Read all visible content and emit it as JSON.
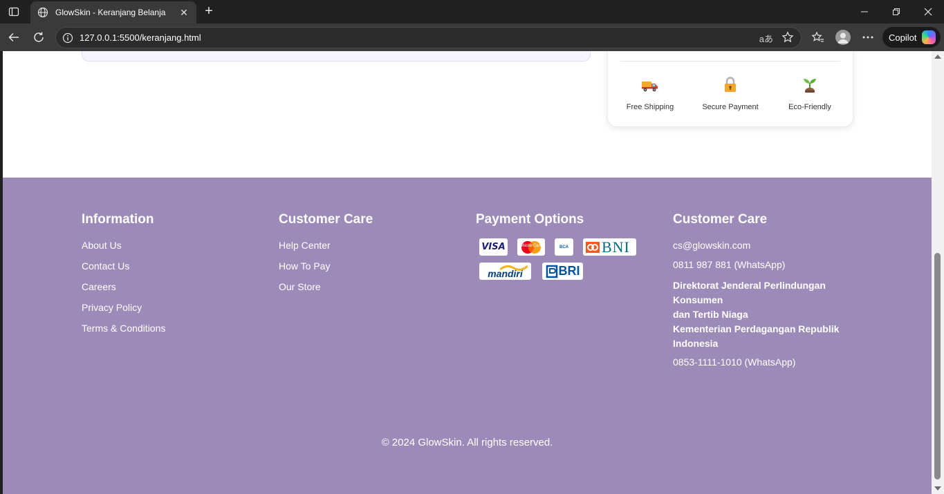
{
  "browser": {
    "tab_title": "GlowSkin - Keranjang Belanja",
    "url": "127.0.0.1:5500/keranjang.html",
    "read_aloud_label": "aあ",
    "copilot_label": "Copilot",
    "new_tab_label": "+",
    "tab_close_label": "✕"
  },
  "features": [
    {
      "label": "Free Shipping",
      "icon": "truck-icon"
    },
    {
      "label": "Secure Payment",
      "icon": "lock-icon"
    },
    {
      "label": "Eco-Friendly",
      "icon": "seedling-icon"
    }
  ],
  "footer": {
    "information": {
      "title": "Information",
      "links": [
        "About Us",
        "Contact Us",
        "Careers",
        "Privacy Policy",
        "Terms & Conditions"
      ]
    },
    "customer_care": {
      "title": "Customer Care",
      "links": [
        "Help Center",
        "How To Pay",
        "Our Store"
      ]
    },
    "payment": {
      "title": "Payment Options",
      "methods": [
        "VISA",
        "MasterCard",
        "BCA",
        "BNI",
        "mandiri",
        "BRI"
      ]
    },
    "contact": {
      "title": "Customer Care",
      "email": "cs@glowskin.com",
      "phone": "0811 987 881 (WhatsApp)",
      "agency_lines": [
        "Direktorat Jenderal Perlindungan Konsumen",
        "dan Tertib Niaga",
        "Kementerian Perdagangan Republik Indonesia"
      ],
      "agency_phone": "0853-1111-1010 (WhatsApp)"
    },
    "copyright": "© 2024 GlowSkin. All rights reserved."
  },
  "colors": {
    "footer_bg": "#9c8ab8",
    "browser_dark": "#202020"
  }
}
